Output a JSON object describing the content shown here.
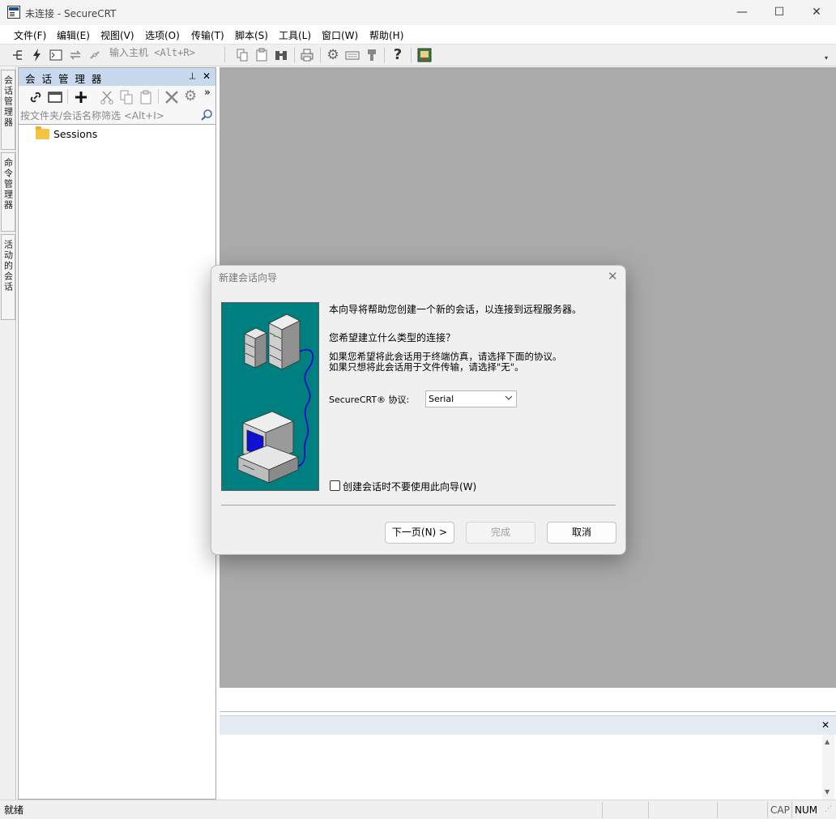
{
  "window": {
    "title": "未连接 - SecureCRT",
    "controls": {
      "minimize": "—",
      "maximize": "☐",
      "close": "✕"
    }
  },
  "menu": [
    "文件(F)",
    "编辑(E)",
    "视图(V)",
    "选项(O)",
    "传输(T)",
    "脚本(S)",
    "工具(L)",
    "窗口(W)",
    "帮助(H)"
  ],
  "toolbar": {
    "quick_connect_placeholder": "输入主机 <Alt+R>",
    "help_glyph": "?",
    "icons": [
      "connect-tree-icon",
      "lightning-icon",
      "terminal-icon",
      "reconnect-icon",
      "disconnect-icon",
      "copy-icon",
      "paste-icon",
      "find-icon",
      "print-icon",
      "settings-icon",
      "keymap-icon",
      "sftp-icon",
      "help-icon",
      "about-icon"
    ]
  },
  "left_tabs": [
    "会话管理器",
    "命令管理器",
    "活动的会话"
  ],
  "session_manager": {
    "title": "会 话 管 理 器",
    "pin": "⊣",
    "close": "✕",
    "overflow": "»",
    "filter_placeholder": "按文件夹/会话名称筛选 <Alt+I>",
    "sessions": [
      {
        "label": "Sessions",
        "icon": "folder-icon"
      }
    ]
  },
  "dialog": {
    "title": "新建会话向导",
    "intro": "本向导将帮助您创建一个新的会话，以连接到远程服务器。",
    "question": "您希望建立什么类型的连接？",
    "hint1": "如果您希望将此会话用于终端仿真，请选择下面的协议。",
    "hint2": "如果只想将此会话用于文件传输，请选择\"无\"。",
    "protocol_label": "SecureCRT® 协议:",
    "protocol_value": "Serial",
    "checkbox_label": "创建会话时不要使用此向导(W)",
    "checkbox_checked": false,
    "buttons": {
      "next": "下一页(N) >",
      "finish": "完成",
      "cancel": "取消"
    }
  },
  "command_panel": {
    "close": "✕",
    "scroll_up": "▲",
    "scroll_down": "▼"
  },
  "statusbar": {
    "ready": "就绪",
    "cap": "CAP",
    "num": "NUM"
  },
  "colors": {
    "teal": "#007f80",
    "workspace": "#aaaaaa",
    "panel_header": "#c9d9ed",
    "screen_blue": "#1010d0"
  }
}
